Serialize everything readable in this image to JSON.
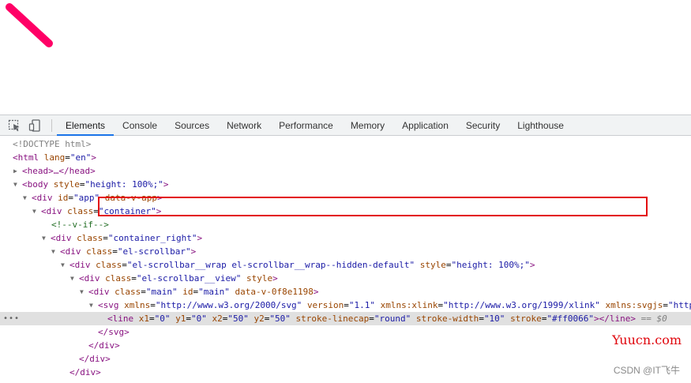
{
  "preview": {
    "line_color": "#ff0066"
  },
  "toolbar": {
    "inspect_icon": "inspect-element-icon",
    "device_icon": "device-toolbar-icon",
    "tabs": [
      "Elements",
      "Console",
      "Sources",
      "Network",
      "Performance",
      "Memory",
      "Application",
      "Security",
      "Lighthouse"
    ],
    "active_tab": "Elements"
  },
  "dom": {
    "doctype": "<!DOCTYPE html>",
    "html_open": "<html",
    "html_attr_name": "lang",
    "html_attr_value": "\"en\"",
    "head_collapsed": "<head>…</head>",
    "body_open": "<body",
    "body_attr_name": "style",
    "body_attr_value": "\"height: 100%;\"",
    "app_open": "<div",
    "app_id_name": "id",
    "app_id_value": "\"app\"",
    "app_extra": "data-v-app",
    "container_open": "<div",
    "container_class_name": "class",
    "container_class_value": "\"container\"",
    "comment_vif": "<!--v-if-->",
    "cright_open": "<div",
    "cright_class_name": "class",
    "cright_class_value": "\"container_right\"",
    "scrollbar_open": "<div",
    "scrollbar_class_name": "class",
    "scrollbar_class_value": "\"el-scrollbar\"",
    "wrap_open": "<div",
    "wrap_class_name": "class",
    "wrap_class_value": "\"el-scrollbar__wrap el-scrollbar__wrap--hidden-default\"",
    "wrap_style_name": "style",
    "wrap_style_value": "\"height: 100%;\"",
    "view_open": "<div",
    "view_class_name": "class",
    "view_class_value": "\"el-scrollbar__view\"",
    "view_style_name": "style",
    "main_open": "<div",
    "main_class_name": "class",
    "main_class_value": "\"main\"",
    "main_id_name": "id",
    "main_id_value": "\"main\"",
    "main_extra": "data-v-0f8e1198",
    "svg_open": "<svg",
    "svg_xmlns_name": "xmlns",
    "svg_xmlns_value": "\"http://www.w3.org/2000/svg\"",
    "svg_version_name": "version",
    "svg_version_value": "\"1.1\"",
    "svg_xlink_name": "xmlns:xlink",
    "svg_xlink_value": "\"http://www.w3.org/1999/xlink\"",
    "svg_svgjs_name": "xmlns:svgjs",
    "svg_svgjs_value": "\"http",
    "line_open": "<line",
    "x1_name": "x1",
    "x1_value": "\"0\"",
    "y1_name": "y1",
    "y1_value": "\"0\"",
    "x2_name": "x2",
    "x2_value": "\"50\"",
    "y2_name": "y2",
    "y2_value": "\"50\"",
    "linecap_name": "stroke-linecap",
    "linecap_value": "\"round\"",
    "width_name": "stroke-width",
    "width_value": "\"10\"",
    "stroke_name": "stroke",
    "stroke_value": "\"#ff0066\"",
    "line_close": "></line>",
    "selected_ref": "== $0",
    "svg_close": "</svg>",
    "div_close": "</div>",
    "row_dots": "•••"
  },
  "watermarks": {
    "yuucn": "Yuucn.com",
    "csdn": "CSDN @IT飞牛"
  },
  "highlight_color": "#e3070c"
}
